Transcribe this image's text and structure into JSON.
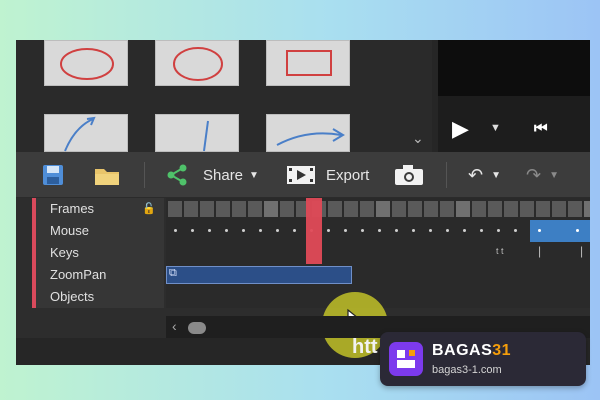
{
  "toolbar": {
    "share_label": "Share",
    "export_label": "Export"
  },
  "timeline": {
    "rows": [
      "Frames",
      "Mouse",
      "Keys",
      "ZoomPan",
      "Objects"
    ]
  },
  "keys_row_text": "t t",
  "bottom_text": "htt",
  "badge": {
    "title_part1": "BAGAS",
    "title_part2": "31",
    "subtitle": "bagas3-1.com"
  },
  "colors": {
    "accent_red": "#e04a57",
    "track_blue": "#3d7fc4",
    "badge_purple": "#7c3aed",
    "badge_orange": "#f59e0b"
  }
}
